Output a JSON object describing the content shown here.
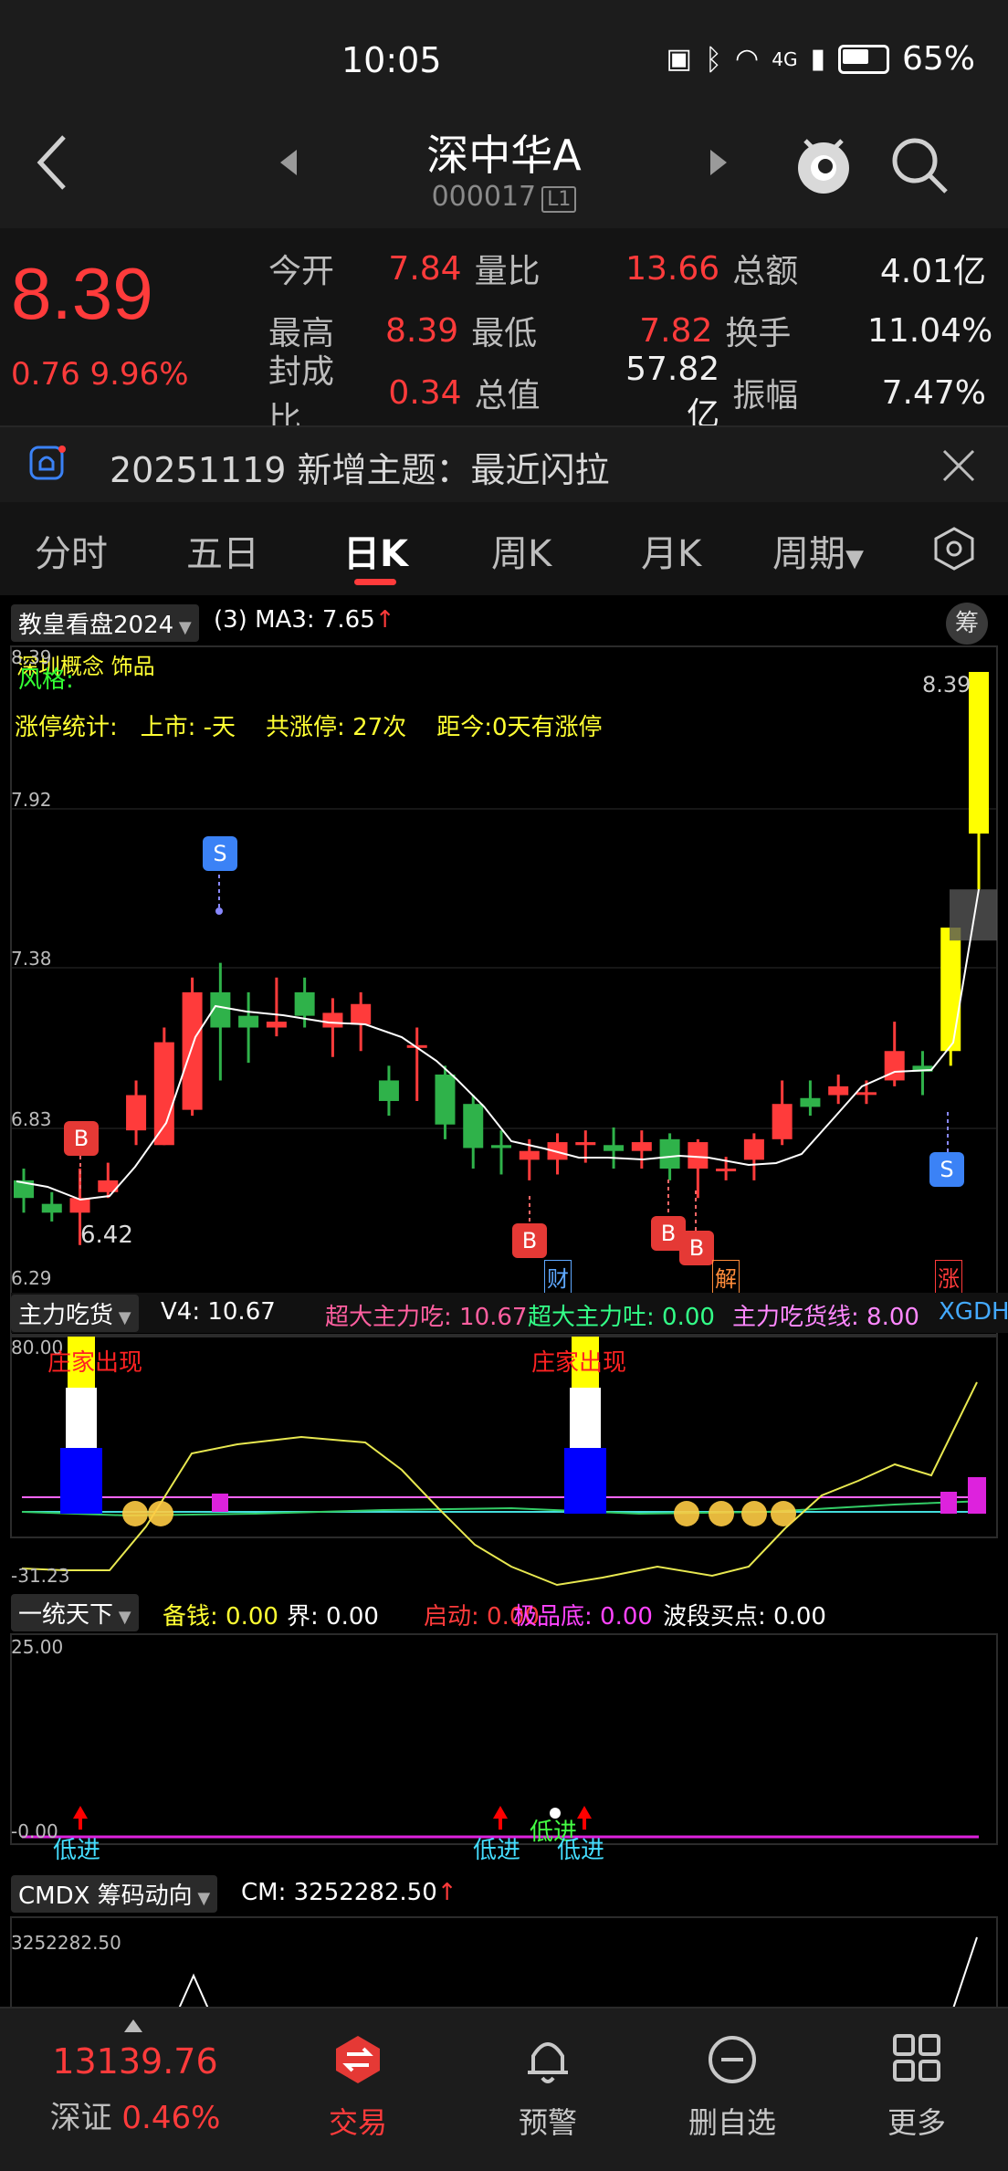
{
  "status": {
    "time": "10:05",
    "battery": "65%",
    "network": "4G"
  },
  "nav": {
    "title": "深中华A",
    "code": "000017",
    "level": "L1"
  },
  "quote": {
    "price": "8.39",
    "change": "0.76",
    "change_pct": "9.96%",
    "rows": [
      [
        {
          "label": "今开",
          "value": "7.84",
          "color": "red"
        },
        {
          "label": "量比",
          "value": "13.66",
          "color": "red"
        },
        {
          "label": "总额",
          "value": "4.01亿",
          "color": "white"
        }
      ],
      [
        {
          "label": "最高",
          "value": "8.39",
          "color": "red"
        },
        {
          "label": "最低",
          "value": "7.82",
          "color": "red"
        },
        {
          "label": "换手",
          "value": "11.04%",
          "color": "white"
        }
      ],
      [
        {
          "label": "封成比",
          "value": "0.34",
          "color": "red"
        },
        {
          "label": "总值",
          "value": "57.82亿",
          "color": "white"
        },
        {
          "label": "振幅",
          "value": "7.47%",
          "color": "white"
        }
      ]
    ]
  },
  "notice": {
    "text": "20251119 新增主题：最近闪拉"
  },
  "tabs": [
    "分时",
    "五日",
    "日K",
    "周K",
    "月K",
    "周期"
  ],
  "active_tab": "日K",
  "main_panel": {
    "indicator": "教皇看盘2024",
    "ma_label": "(3) MA3: 7.65",
    "ma_arrow": "↑",
    "badge": "筹",
    "overlay1": "深圳概念 饰品",
    "overlay2": "风格:",
    "stats_label": "涨停统计:",
    "stats_list": "上市: -天",
    "stats_count": "共涨停: 27次",
    "stats_since": "距今:0天有涨停",
    "yaxis": [
      "8.39",
      "7.92",
      "7.38",
      "6.83",
      "6.29"
    ],
    "right_price": "8.39",
    "low_label": "6.42",
    "markers": {
      "s": "S",
      "b": "B",
      "cai": "财",
      "jie": "解",
      "zhang": "涨"
    }
  },
  "panel2": {
    "indicator": "主力吃货",
    "v4": "V4: 10.67",
    "chi": "超大主力吃: 10.67",
    "tu": "超大主力吐: 0.00",
    "line": "主力吃货线: 8.00",
    "extra": "XGDH",
    "ymax": "80.00",
    "ymin": "-31.23",
    "signal": "庄家出现"
  },
  "panel3": {
    "indicator": "一统天下",
    "bq": "备钱: 0.00",
    "jie": "界: 0.00",
    "qd": "启动: 0.00",
    "jpd": "极品底: 0.00",
    "bd": "波段买点: 0.00",
    "ymax": "25.00",
    "ymin": "-0.00",
    "signal": "低进"
  },
  "panel4": {
    "indicator": "CMDX 筹码动向",
    "cm": "CM: 3252282.50",
    "arrow": "↑",
    "ymax": "3252282.50"
  },
  "bottom": {
    "index_value": "13139.76",
    "index_name": "深证",
    "index_pct": "0.46%",
    "items": [
      "交易",
      "预警",
      "删自选",
      "更多"
    ]
  },
  "colors": {
    "up": "#ff3b3b",
    "down": "#2fb24a",
    "accent": "#e53935",
    "yellow": "#ffff00",
    "blue": "#0000ff"
  },
  "chart_data": {
    "type": "candlestick",
    "ylim": [
      6.29,
      8.39
    ],
    "candles": [
      {
        "o": 6.66,
        "c": 6.6,
        "h": 6.7,
        "l": 6.55
      },
      {
        "o": 6.58,
        "c": 6.55,
        "h": 6.62,
        "l": 6.52
      },
      {
        "o": 6.55,
        "c": 6.6,
        "h": 6.7,
        "l": 6.44
      },
      {
        "o": 6.62,
        "c": 6.66,
        "h": 6.72,
        "l": 6.6
      },
      {
        "o": 6.83,
        "c": 6.95,
        "h": 7.0,
        "l": 6.78
      },
      {
        "o": 6.78,
        "c": 7.13,
        "h": 7.18,
        "l": 6.78
      },
      {
        "o": 6.9,
        "c": 7.3,
        "h": 7.35,
        "l": 6.88
      },
      {
        "o": 7.3,
        "c": 7.18,
        "h": 7.4,
        "l": 7.0
      },
      {
        "o": 7.22,
        "c": 7.18,
        "h": 7.3,
        "l": 7.06
      },
      {
        "o": 7.18,
        "c": 7.2,
        "h": 7.35,
        "l": 7.15
      },
      {
        "o": 7.3,
        "c": 7.22,
        "h": 7.35,
        "l": 7.18
      },
      {
        "o": 7.18,
        "c": 7.23,
        "h": 7.28,
        "l": 7.08
      },
      {
        "o": 7.19,
        "c": 7.26,
        "h": 7.3,
        "l": 7.1
      },
      {
        "o": 7.0,
        "c": 6.93,
        "h": 7.05,
        "l": 6.88
      },
      {
        "o": 7.12,
        "c": 7.12,
        "h": 7.18,
        "l": 6.93
      },
      {
        "o": 7.02,
        "c": 6.85,
        "h": 7.05,
        "l": 6.8
      },
      {
        "o": 6.92,
        "c": 6.77,
        "h": 6.95,
        "l": 6.7
      },
      {
        "o": 6.78,
        "c": 6.77,
        "h": 6.83,
        "l": 6.68
      },
      {
        "o": 6.73,
        "c": 6.76,
        "h": 6.8,
        "l": 6.66
      },
      {
        "o": 6.73,
        "c": 6.79,
        "h": 6.82,
        "l": 6.68
      },
      {
        "o": 6.78,
        "c": 6.79,
        "h": 6.83,
        "l": 6.72
      },
      {
        "o": 6.78,
        "c": 6.76,
        "h": 6.84,
        "l": 6.7
      },
      {
        "o": 6.76,
        "c": 6.79,
        "h": 6.83,
        "l": 6.7
      },
      {
        "o": 6.8,
        "c": 6.7,
        "h": 6.82,
        "l": 6.66
      },
      {
        "o": 6.7,
        "c": 6.79,
        "h": 6.8,
        "l": 6.6
      },
      {
        "o": 6.7,
        "c": 6.7,
        "h": 6.74,
        "l": 6.66
      },
      {
        "o": 6.73,
        "c": 6.8,
        "h": 6.82,
        "l": 6.66
      },
      {
        "o": 6.8,
        "c": 6.92,
        "h": 7.0,
        "l": 6.78
      },
      {
        "o": 6.94,
        "c": 6.91,
        "h": 7.0,
        "l": 6.88
      },
      {
        "o": 6.95,
        "c": 6.98,
        "h": 7.02,
        "l": 6.92
      },
      {
        "o": 6.96,
        "c": 6.96,
        "h": 7.0,
        "l": 6.92
      },
      {
        "o": 7.0,
        "c": 7.1,
        "h": 7.2,
        "l": 6.98
      },
      {
        "o": 7.05,
        "c": 7.03,
        "h": 7.1,
        "l": 6.95
      },
      {
        "o": 7.1,
        "c": 7.52,
        "h": 7.52,
        "l": 7.05
      },
      {
        "o": 7.84,
        "c": 8.39,
        "h": 8.39,
        "l": 7.65
      }
    ]
  }
}
